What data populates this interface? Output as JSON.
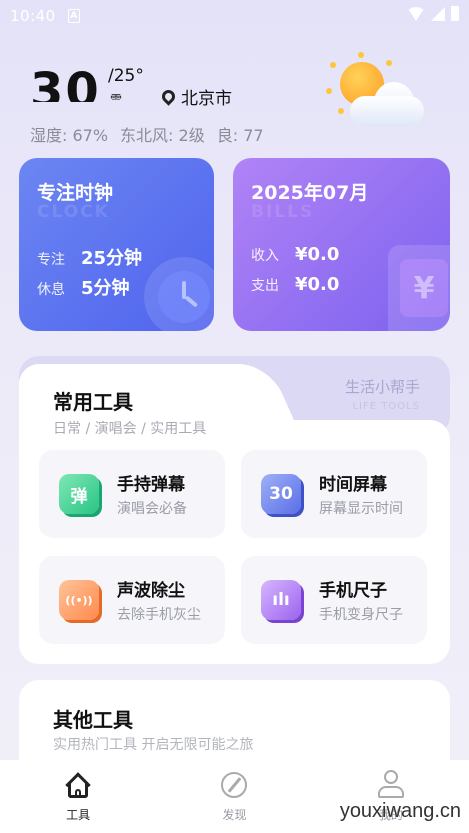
{
  "status_bar": {
    "time": "10:40",
    "notif_glyph": "A"
  },
  "weather": {
    "temp": "30",
    "temp_low": "/25°",
    "condition": "雷",
    "location": "北京市",
    "humidity": "湿度: 67%",
    "wind": "东北风: 2级",
    "aqi": "良: 77",
    "icon": "sun-cloud-icon"
  },
  "clock_card": {
    "title": "专注时钟",
    "watermark": "CLOCK",
    "focus_label": "专注",
    "focus_value": "25分钟",
    "rest_label": "休息",
    "rest_value": "5分钟",
    "color": "#5a6ef0"
  },
  "finance_card": {
    "title": "2025年07月",
    "watermark": "BILLS",
    "income_label": "收入",
    "income_value": "¥0.0",
    "expense_label": "支出",
    "expense_value": "¥0.0",
    "deco_glyph": "¥",
    "color": "#8a67f0"
  },
  "tools": {
    "title": "常用工具",
    "subtitle": "日常 / 演唱会 / 实用工具",
    "helper_title": "生活小帮手",
    "helper_sub": "LIFE TOOLS",
    "items": [
      {
        "name": "手持弹幕",
        "desc": "演唱会必备",
        "glyph": "弹",
        "icon": "danmaku-icon"
      },
      {
        "name": "时间屏幕",
        "desc": "屏幕显示时间",
        "glyph": "30",
        "icon": "time-screen-icon"
      },
      {
        "name": "声波除尘",
        "desc": "去除手机灰尘",
        "glyph": "((•))",
        "icon": "soundwave-icon"
      },
      {
        "name": "手机尺子",
        "desc": "手机变身尺子",
        "glyph": "ılı",
        "icon": "ruler-icon"
      }
    ]
  },
  "other_tools": {
    "title": "其他工具",
    "subtitle": "实用热门工具 开启无限可能之旅"
  },
  "nav": {
    "items": [
      {
        "label": "工具",
        "icon": "home-icon",
        "active": true
      },
      {
        "label": "发现",
        "icon": "compass-icon",
        "active": false
      },
      {
        "label": "我的",
        "icon": "user-icon",
        "active": false
      }
    ]
  },
  "site_watermark": "youxiwang.cn"
}
